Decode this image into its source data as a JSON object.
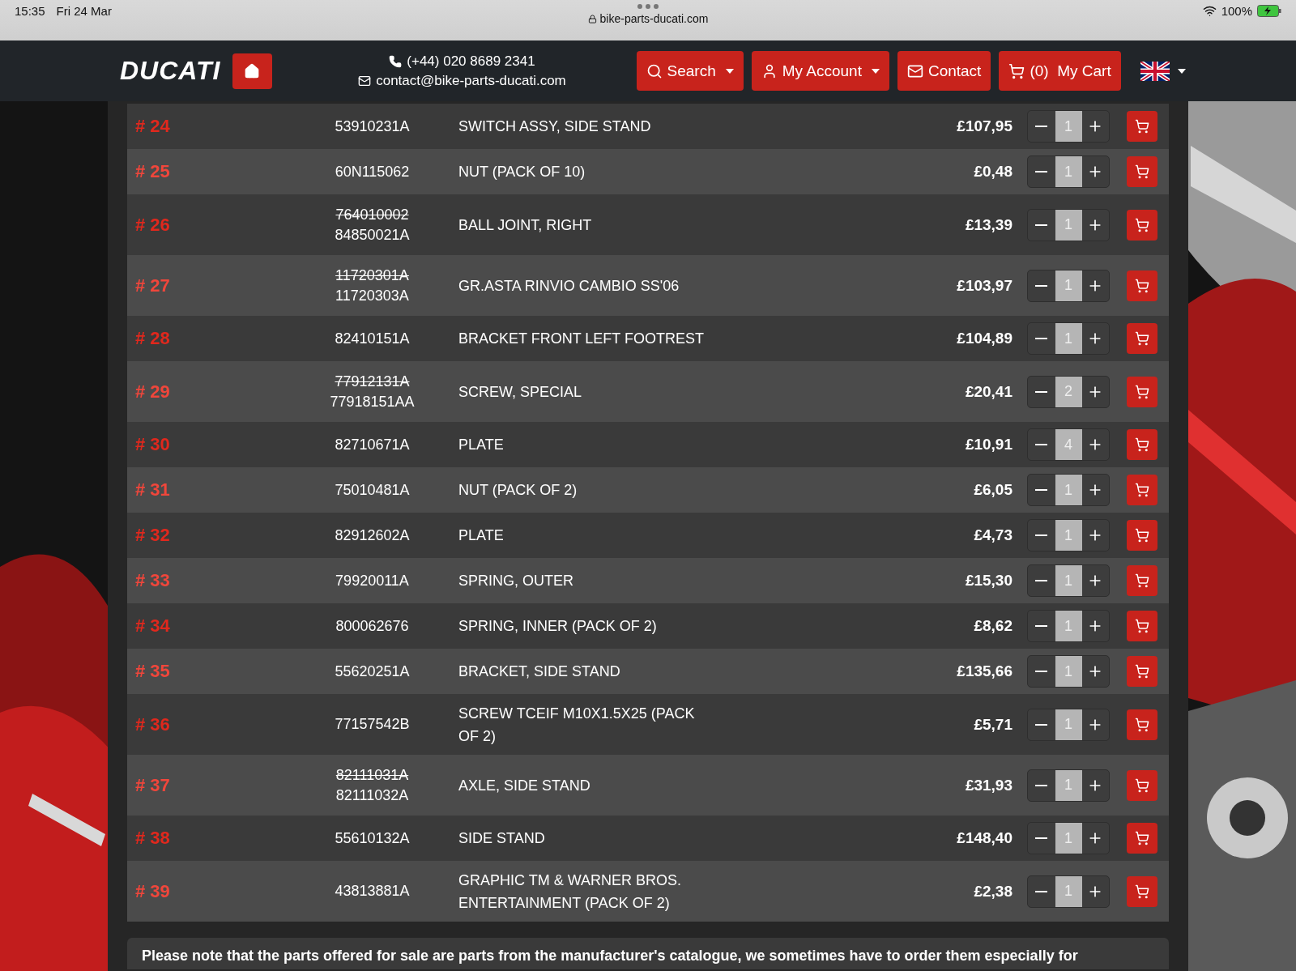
{
  "status_bar": {
    "time": "15:35",
    "date": "Fri 24 Mar",
    "url": "bike-parts-ducati.com",
    "battery": "100%"
  },
  "header": {
    "logo": "DUCATI",
    "phone": "(+44) 020 8689 2341",
    "email": "contact@bike-parts-ducati.com",
    "buttons": [
      {
        "kind": "search",
        "label": "Search",
        "dropdown": true
      },
      {
        "kind": "account",
        "label": "My Account",
        "dropdown": true
      },
      {
        "kind": "contact",
        "label": "Contact",
        "dropdown": false
      },
      {
        "kind": "cart",
        "count": "(0)",
        "label": "My Cart",
        "dropdown": false
      }
    ]
  },
  "rows": [
    {
      "index": "# 24",
      "ref": "53910231A",
      "description": "SWITCH ASSY, SIDE STAND",
      "price": "£107,95",
      "quantity": "1"
    },
    {
      "index": "# 25",
      "ref": "60N115062",
      "description": "NUT (PACK OF 10)",
      "price": "£0,48",
      "quantity": "1"
    },
    {
      "index": "# 26",
      "old_ref": "764010002",
      "ref": "84850021A",
      "description": "BALL JOINT, RIGHT",
      "price": "£13,39",
      "quantity": "1"
    },
    {
      "index": "# 27",
      "old_ref": "11720301A",
      "ref": "11720303A",
      "description": "GR.ASTA RINVIO CAMBIO SS'06",
      "price": "£103,97",
      "quantity": "1"
    },
    {
      "index": "# 28",
      "ref": "82410151A",
      "description": "BRACKET FRONT LEFT FOOTREST",
      "price": "£104,89",
      "quantity": "1"
    },
    {
      "index": "# 29",
      "old_ref": "77912131A",
      "ref": "77918151AA",
      "description": "SCREW, SPECIAL",
      "price": "£20,41",
      "quantity": "2"
    },
    {
      "index": "# 30",
      "ref": "82710671A",
      "description": "PLATE",
      "price": "£10,91",
      "quantity": "4"
    },
    {
      "index": "# 31",
      "ref": "75010481A",
      "description": "NUT (PACK OF 2)",
      "price": "£6,05",
      "quantity": "1"
    },
    {
      "index": "# 32",
      "ref": "82912602A",
      "description": "PLATE",
      "price": "£4,73",
      "quantity": "1"
    },
    {
      "index": "# 33",
      "ref": "79920011A",
      "description": "SPRING, OUTER",
      "price": "£15,30",
      "quantity": "1"
    },
    {
      "index": "# 34",
      "ref": "800062676",
      "description": "SPRING, INNER (PACK OF 2)",
      "price": "£8,62",
      "quantity": "1"
    },
    {
      "index": "# 35",
      "ref": "55620251A",
      "description": "BRACKET, SIDE STAND",
      "price": "£135,66",
      "quantity": "1"
    },
    {
      "index": "# 36",
      "ref": "77157542B",
      "description": "SCREW TCEIF M10X1.5X25 (PACK OF 2)",
      "price": "£5,71",
      "quantity": "1"
    },
    {
      "index": "# 37",
      "old_ref": "82111031A",
      "ref": "82111032A",
      "description": "AXLE, SIDE STAND",
      "price": "£31,93",
      "quantity": "1"
    },
    {
      "index": "# 38",
      "ref": "55610132A",
      "description": "SIDE STAND",
      "price": "£148,40",
      "quantity": "1"
    },
    {
      "index": "# 39",
      "ref": "43813881A",
      "description": "GRAPHIC TM & WARNER BROS. ENTERTAINMENT (PACK OF 2)",
      "price": "£2,38",
      "quantity": "1"
    }
  ],
  "note": "Please note that the parts offered for sale are parts from the manufacturer's catalogue, we sometimes have to order them especially for"
}
